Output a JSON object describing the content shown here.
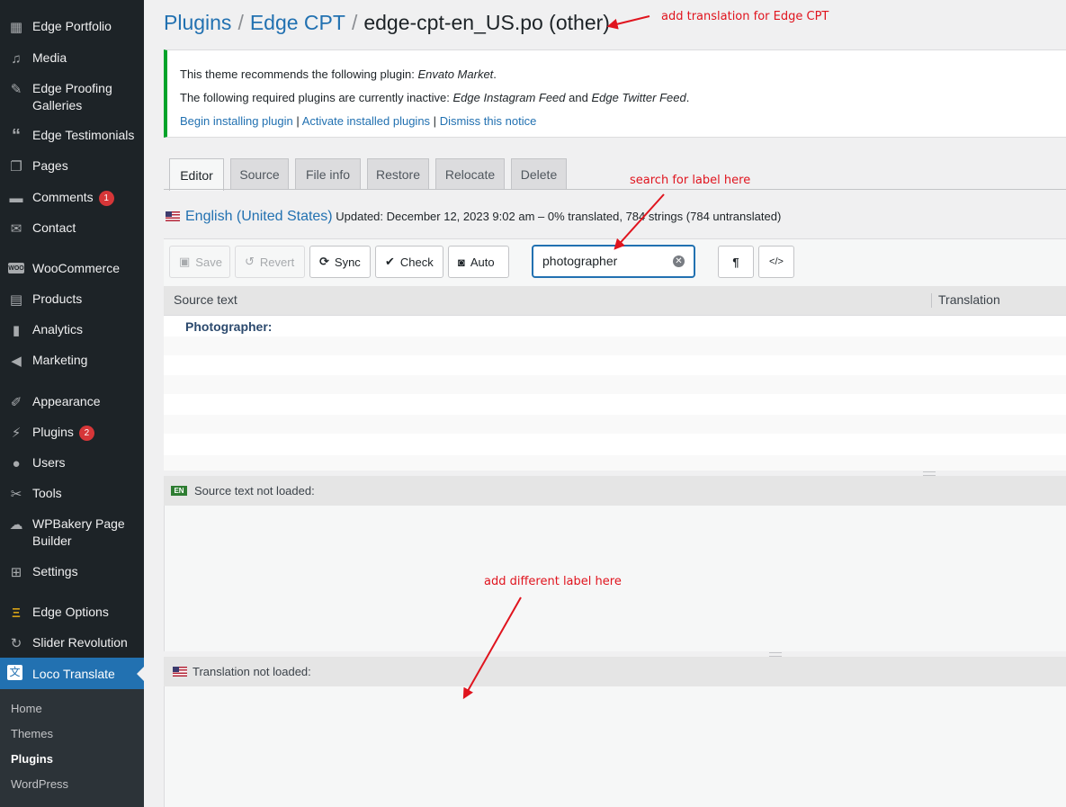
{
  "sidebar": {
    "items": [
      {
        "label": "Edge Portfolio",
        "icon": "grid-icon"
      },
      {
        "label": "Media",
        "icon": "media-icon"
      },
      {
        "label": "Edge Proofing Galleries",
        "icon": "pin-icon"
      },
      {
        "label": "Edge Testimonials",
        "icon": "quote-icon"
      },
      {
        "label": "Pages",
        "icon": "pages-icon"
      },
      {
        "label": "Comments",
        "icon": "comment-icon",
        "badge": "1"
      },
      {
        "label": "Contact",
        "icon": "mail-icon"
      },
      {
        "label": "WooCommerce",
        "icon": "woo-icon"
      },
      {
        "label": "Products",
        "icon": "archive-icon"
      },
      {
        "label": "Analytics",
        "icon": "chart-icon"
      },
      {
        "label": "Marketing",
        "icon": "megaphone-icon"
      },
      {
        "label": "Appearance",
        "icon": "brush-icon"
      },
      {
        "label": "Plugins",
        "icon": "plug-icon",
        "badge": "2"
      },
      {
        "label": "Users",
        "icon": "user-icon"
      },
      {
        "label": "Tools",
        "icon": "wrench-icon"
      },
      {
        "label": "WPBakery Page Builder",
        "icon": "cloud-icon"
      },
      {
        "label": "Settings",
        "icon": "sliders-icon"
      },
      {
        "label": "Edge Options",
        "icon": "options-icon"
      },
      {
        "label": "Slider Revolution",
        "icon": "refresh-icon"
      },
      {
        "label": "Loco Translate",
        "icon": "translate-icon"
      }
    ],
    "submenu": [
      "Home",
      "Themes",
      "Plugins",
      "WordPress"
    ]
  },
  "header": {
    "crumb1": "Plugins",
    "crumb2": "Edge CPT",
    "file": "edge-cpt-en_US.po (other)"
  },
  "notice": {
    "line1_prefix": "This theme recommends the following plugin: ",
    "line1_plugin": "Envato Market",
    "line1_suffix": ".",
    "line2_prefix": "The following required plugins are currently inactive: ",
    "line2_plugin1": "Edge Instagram Feed",
    "line2_and": " and ",
    "line2_plugin2": "Edge Twitter Feed",
    "line2_suffix": ".",
    "link_install": "Begin installing plugin",
    "link_activate": "Activate installed plugins",
    "link_dismiss": "Dismiss this notice",
    "separator": "|"
  },
  "tabs": [
    "Editor",
    "Source",
    "File info",
    "Restore",
    "Relocate",
    "Delete"
  ],
  "locale": {
    "name": "English (United States)",
    "status": "Updated: December 12, 2023 9:02 am – 0% translated, 784 strings (784 untranslated)"
  },
  "toolbar": {
    "save": "Save",
    "revert": "Revert",
    "sync": "Sync",
    "check": "Check",
    "auto": "Auto",
    "search_value": "photographer",
    "pilcrow": "¶",
    "code": "</>"
  },
  "grid": {
    "col_source": "Source text",
    "col_translation": "Translation",
    "rows": [
      "Photographer:"
    ]
  },
  "source_pane": {
    "badge": "EN",
    "label": "Source text not loaded:"
  },
  "translation_pane": {
    "label": "Translation not loaded:"
  },
  "annotations": {
    "note1": "add translation for Edge CPT",
    "note2": "search for label here",
    "note3": "add different label here",
    "color": "#e0141e"
  },
  "colors": {
    "accent": "#2271b1",
    "sidebar": "#1d2327",
    "notice_border": "#00a32a",
    "badge": "#d63638"
  }
}
